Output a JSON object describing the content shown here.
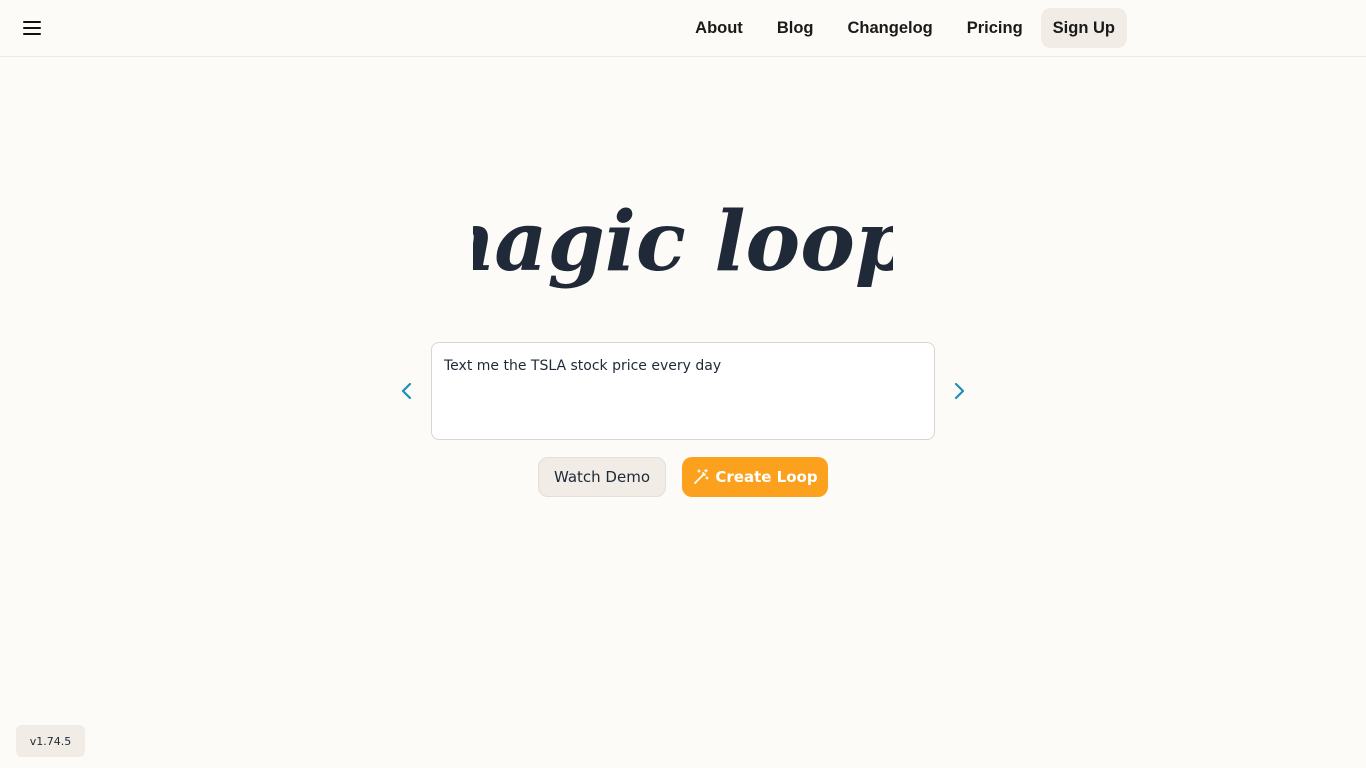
{
  "header": {
    "menu_icon": "hamburger-menu-icon",
    "nav": {
      "about": "About",
      "blog": "Blog",
      "changelog": "Changelog",
      "pricing": "Pricing",
      "signup": "Sign Up"
    }
  },
  "hero": {
    "logo_text": "magic loops",
    "prompt_value": "Text me the TSLA stock price every day",
    "prev_icon": "chevron-left-icon",
    "next_icon": "chevron-right-icon"
  },
  "actions": {
    "watch_demo": "Watch Demo",
    "create_loop": "Create Loop",
    "create_icon": "magic-wand-icon"
  },
  "footer": {
    "version": "v1.74.5"
  },
  "colors": {
    "background": "#fdfbf7",
    "accent": "#fba11e",
    "arrow": "#1d8fb8",
    "logo": "#1f2937"
  }
}
